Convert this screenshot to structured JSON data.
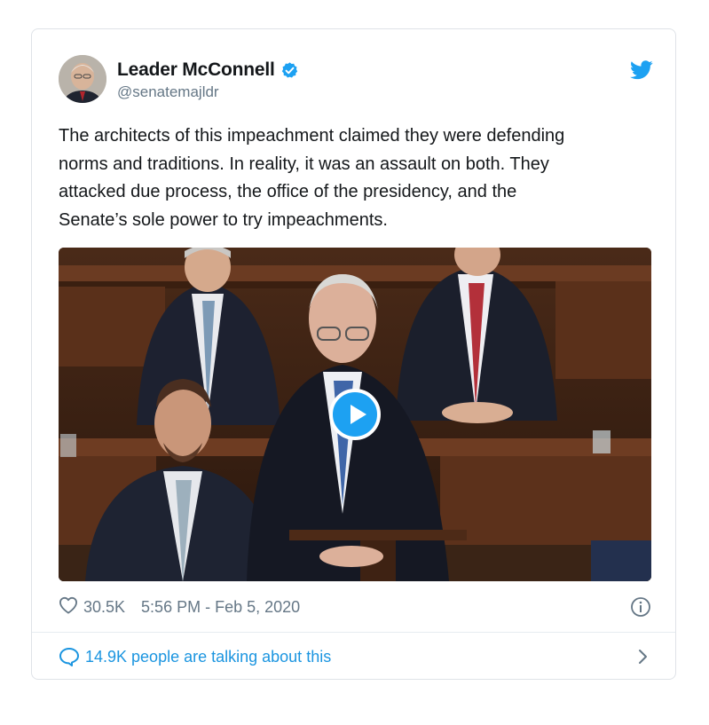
{
  "tweet": {
    "display_name": "Leader McConnell",
    "handle": "@senatemajldr",
    "verified": true,
    "text": "The architects of this impeachment claimed they were defending\nnorms and traditions. In reality, it was an assault on both. They\nattacked due process, the office of the presidency, and the\nSenate’s sole power to try impeachments.",
    "media": {
      "type": "video",
      "play_icon": "play-icon"
    },
    "likes": "30.5K",
    "timestamp": "5:56 PM - Feb 5, 2020",
    "talking_about": "14.9K people are talking about this"
  },
  "icons": {
    "verified": "verified-badge-icon",
    "brand": "twitter-bird-icon",
    "like": "heart-icon",
    "info": "info-icon",
    "reply": "speech-bubble-icon",
    "chevron": "chevron-right-icon"
  },
  "colors": {
    "accent": "#1da1f2",
    "link": "#1b95e0",
    "muted": "#657786",
    "text": "#14171a",
    "border": "#dfe3e8"
  }
}
